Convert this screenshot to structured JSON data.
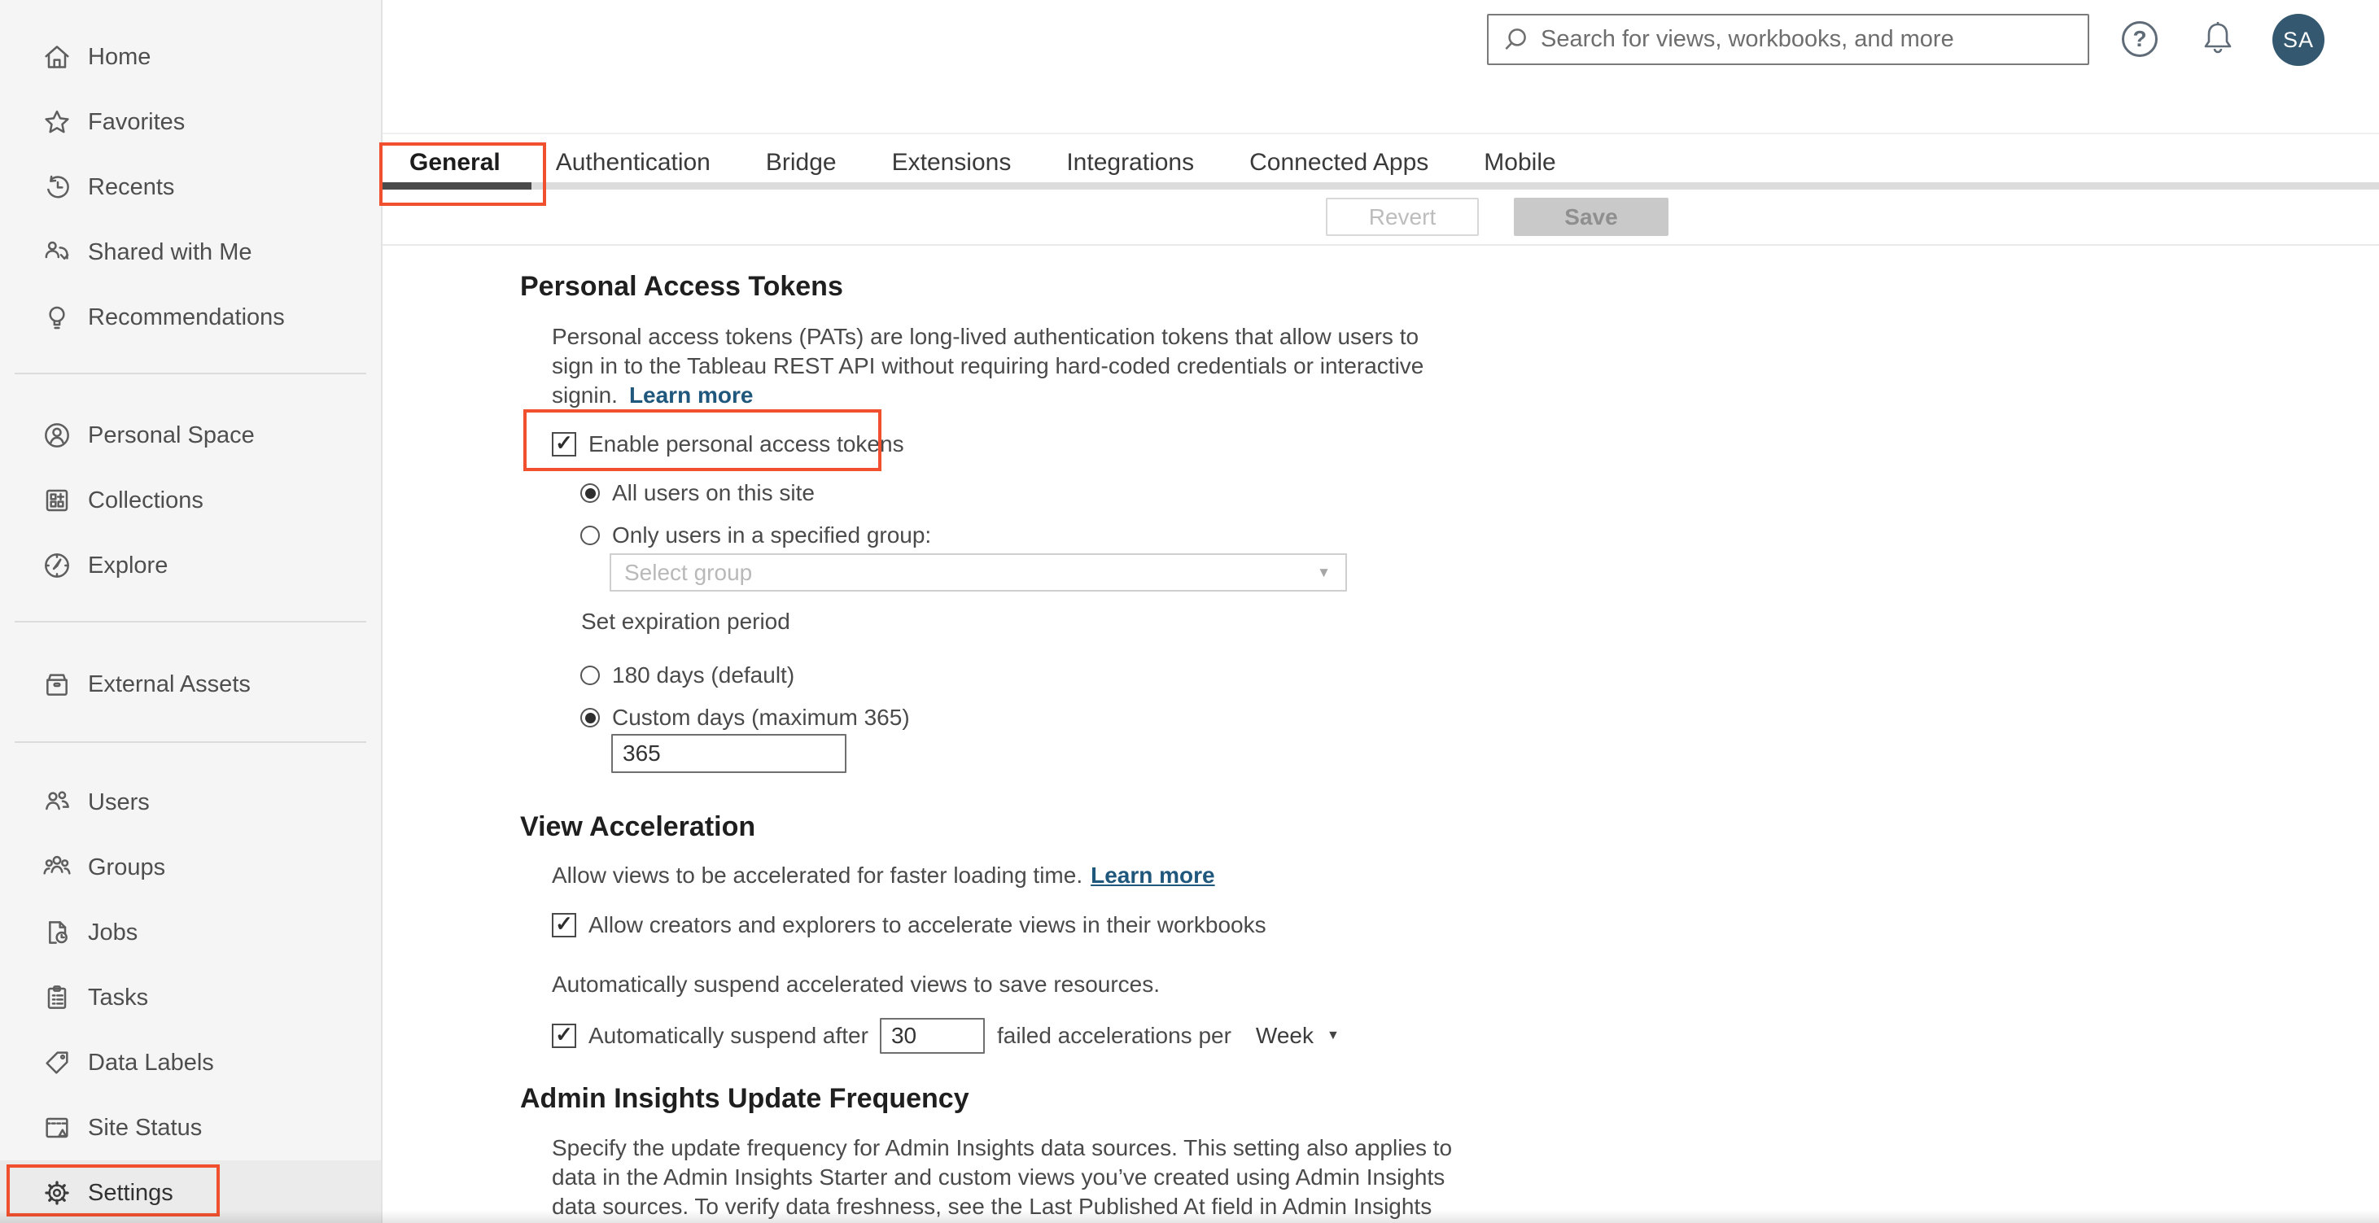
{
  "header": {
    "search_placeholder": "Search for views, workbooks, and more",
    "help_glyph": "?",
    "avatar_initials": "SA"
  },
  "sidebar": {
    "selected": "Settings",
    "groups": [
      [
        {
          "label": "Home",
          "icon": "home-icon"
        },
        {
          "label": "Favorites",
          "icon": "star-icon"
        },
        {
          "label": "Recents",
          "icon": "recents-clock-icon"
        },
        {
          "label": "Shared with Me",
          "icon": "shared-with-me-icon"
        },
        {
          "label": "Recommendations",
          "icon": "lightbulb-icon"
        }
      ],
      [
        {
          "label": "Personal Space",
          "icon": "person-circle-icon"
        },
        {
          "label": "Collections",
          "icon": "collections-grid-icon"
        },
        {
          "label": "Explore",
          "icon": "compass-icon"
        }
      ],
      [
        {
          "label": "External Assets",
          "icon": "drawer-icon"
        }
      ],
      [
        {
          "label": "Users",
          "icon": "users-icon"
        },
        {
          "label": "Groups",
          "icon": "groups-icon"
        },
        {
          "label": "Jobs",
          "icon": "document-clock-icon"
        },
        {
          "label": "Tasks",
          "icon": "clipboard-icon"
        },
        {
          "label": "Data Labels",
          "icon": "tag-icon"
        },
        {
          "label": "Site Status",
          "icon": "site-status-icon"
        },
        {
          "label": "Settings",
          "icon": "gear-icon",
          "annotated": true
        }
      ]
    ]
  },
  "tabs": {
    "items": [
      "General",
      "Authentication",
      "Bridge",
      "Extensions",
      "Integrations",
      "Connected Apps",
      "Mobile"
    ],
    "selected_index": 0
  },
  "toolbar": {
    "revert_label": "Revert",
    "save_label": "Save"
  },
  "sections": {
    "pat": {
      "title": "Personal Access Tokens",
      "description": "Personal access tokens (PATs) are long-lived authentication tokens that allow users to\nsign in to the Tableau REST API without requiring hard-coded credentials or interactive\nsignin.",
      "learn_more_label": "Learn more",
      "enable_label": "Enable personal access tokens",
      "enable_checked": true,
      "scope_all_label": "All users on this site",
      "scope_group_label": "Only users in a specified group:",
      "scope_selected": "all",
      "group_select_placeholder": "Select group",
      "expiration_label": "Set expiration period",
      "exp_default_label": "180 days (default)",
      "exp_custom_label": "Custom days (maximum 365)",
      "expiration_selected": "custom",
      "custom_days_value": "365"
    },
    "view_acceleration": {
      "title": "View Acceleration",
      "intro": "Allow views to be accelerated for faster loading time.",
      "learn_more_label": "Learn more",
      "allow_label": "Allow creators and explorers to accelerate views in their workbooks",
      "allow_checked": true,
      "suspend_info": "Automatically suspend accelerated views to save resources.",
      "suspend_prefix": "Automatically suspend after",
      "suspend_count": "30",
      "suspend_checked": true,
      "suspend_suffix": "failed accelerations per",
      "suspend_period": "Week"
    },
    "admin_insights": {
      "title": "Admin Insights Update Frequency",
      "description": "Specify the update frequency for Admin Insights data sources. This setting also applies to\ndata in the Admin Insights Starter and custom views you’ve created using Admin Insights\ndata sources. To verify data freshness, see the Last Published At field in Admin Insights"
    }
  },
  "colors": {
    "annotation_red": "#f1502e",
    "link_blue": "#20577c",
    "avatar_bg": "#33586f",
    "selected_tab_underline": "#4a4a4a"
  }
}
